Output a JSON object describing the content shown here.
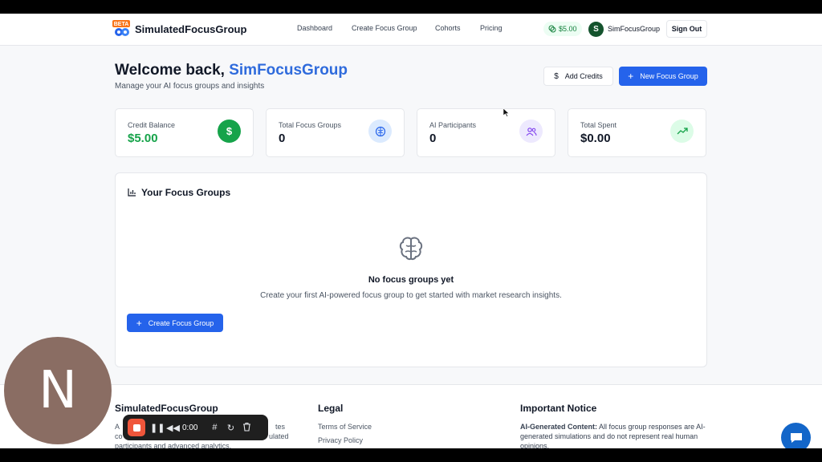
{
  "header": {
    "beta_badge": "BETA",
    "brand": "SimulatedFocusGroup",
    "nav": [
      "Dashboard",
      "Create Focus Group",
      "Cohorts",
      "Pricing"
    ],
    "credit_pill": "$5.00",
    "avatar_initial": "S",
    "username": "SimFocusGroup",
    "sign_out": "Sign Out"
  },
  "welcome": {
    "prefix": "Welcome back, ",
    "name": "SimFocusGroup",
    "subtitle": "Manage your AI focus groups and insights",
    "add_credits": "Add Credits",
    "new_focus_group": "New Focus Group"
  },
  "stats": [
    {
      "label": "Credit Balance",
      "value": "$5.00",
      "icon": "dollar-icon",
      "color": "#16a34a"
    },
    {
      "label": "Total Focus Groups",
      "value": "0",
      "icon": "brain-icon",
      "color": "#2563eb"
    },
    {
      "label": "AI Participants",
      "value": "0",
      "icon": "users-icon",
      "color": "#7c3aed"
    },
    {
      "label": "Total Spent",
      "value": "$0.00",
      "icon": "trending-up-icon",
      "color": "#16a34a"
    }
  ],
  "focus_groups": {
    "title": "Your Focus Groups",
    "empty_title": "No focus groups yet",
    "empty_text": "Create your first AI-powered focus group to get started with market research insights.",
    "create_button": "Create Focus Group"
  },
  "footer": {
    "col1_title": "SimulatedFocusGroup",
    "col1_line1": "A",
    "col1_line1_right": "tes",
    "col1_line2_left": "co",
    "col1_line2_right": "ulated",
    "col1_line3": "participants and advanced analytics.",
    "col2_title": "Legal",
    "legal_links": [
      "Terms of Service",
      "Privacy Policy"
    ],
    "col3_title": "Important Notice",
    "notice_bold": "AI-Generated Content:",
    "notice_text": " All focus group responses are AI-",
    "notice_line2": "generated simulations and do not represent real human",
    "notice_line3": "opinions."
  },
  "webcam": {
    "initial": "N"
  },
  "recorder": {
    "time": "0:00"
  }
}
